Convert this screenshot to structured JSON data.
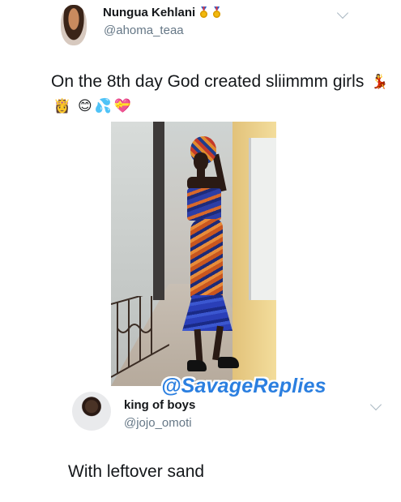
{
  "tweet": {
    "author_name": "Nungua Kehlani",
    "author_handle": "@ahoma_teaa",
    "name_emoji": [
      "medal-icon",
      "medal-icon"
    ],
    "text": "On the 8th day God created sliimmm girls",
    "text_emoji": [
      "dancer-icon",
      "princess-icon",
      "smiling-face-icon",
      "sweat-droplets-icon",
      "heart-ribbon-icon"
    ]
  },
  "watermark": "@SavageReplies",
  "reply": {
    "author_name": "king of boys",
    "author_handle": "@jojo_omoti",
    "text": "With leftover sand"
  },
  "colors": {
    "text_primary": "#14171a",
    "text_secondary": "#657786",
    "watermark": "#2b7fe0",
    "chevron": "#aab8c2"
  }
}
